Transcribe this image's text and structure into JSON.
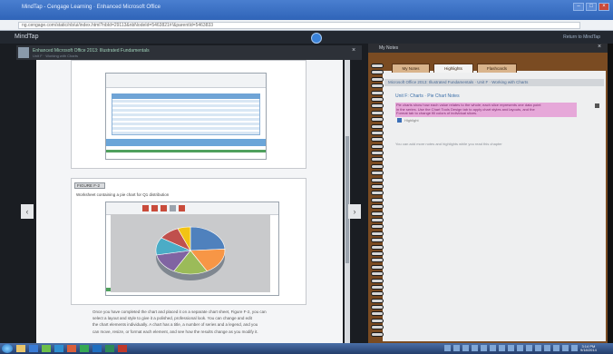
{
  "browser": {
    "tab_title": "MindTap - Cengage Learning · Enhanced Microsoft Office",
    "url": "ng.cengage.com/static/nb/ui/index.html?nbId=29113&nbNodeId=5463821#!&parentId=5463833",
    "window_buttons": {
      "minimize": "–",
      "maximize": "□",
      "close": "×"
    }
  },
  "app": {
    "logo": "MindTap",
    "right_link": "Return to MindTap"
  },
  "reader": {
    "title": "Enhanced Microsoft Office 2013: Illustrated Fundamentals",
    "subtitle": "Unit F · Working with Charts",
    "close_label": "×",
    "prev_label": "‹",
    "next_label": "›"
  },
  "figure2": {
    "tag": "FIGURE F-2",
    "caption": "Worksheet containing a pie chart for Q1 distribution"
  },
  "body_text": [
    "Once you have completed the chart and placed it on a separate chart sheet, Figure F-2, you can",
    "select a layout and style to give it a polished, professional look. You can change and edit",
    "the chart elements individually. A chart has a title, a number of series and a legend, and you",
    "can move, resize, or format each element, and see how the results change as you modify it."
  ],
  "notes": {
    "top_label": "My Notes",
    "close_label": "×",
    "tabs": [
      "My Notes",
      "Highlights",
      "Flashcards"
    ],
    "banner": "Microsoft Office 2013: Illustrated Fundamentals · Unit F · Working with Charts",
    "heading": "Unit F: Charts · Pie Chart Notes",
    "highlight": [
      "Pie charts show how each value relates to the whole; each slice represents one data point",
      "in the series. Use the Chart Tools Design tab to apply chart styles and layouts, and the",
      "Format tab to change fill colors of individual slices."
    ],
    "meta": "Highlight",
    "footer": "You can add more notes and highlights while you read this chapter"
  },
  "taskbar": {
    "clock_time": "3:14 PM",
    "clock_date": "9/18/2014"
  },
  "colors": {
    "accent": "#3a82d8",
    "notes_frame": "#7a4b22",
    "highlight": "#e6a8d9"
  },
  "chart_data": {
    "type": "pie",
    "values": [
      24,
      18,
      16,
      14,
      12,
      10,
      6
    ],
    "colors": [
      "#4f81bd",
      "#f79646",
      "#9bbb59",
      "#8064a2",
      "#4bacc6",
      "#c0504d",
      "#f2c314"
    ]
  }
}
